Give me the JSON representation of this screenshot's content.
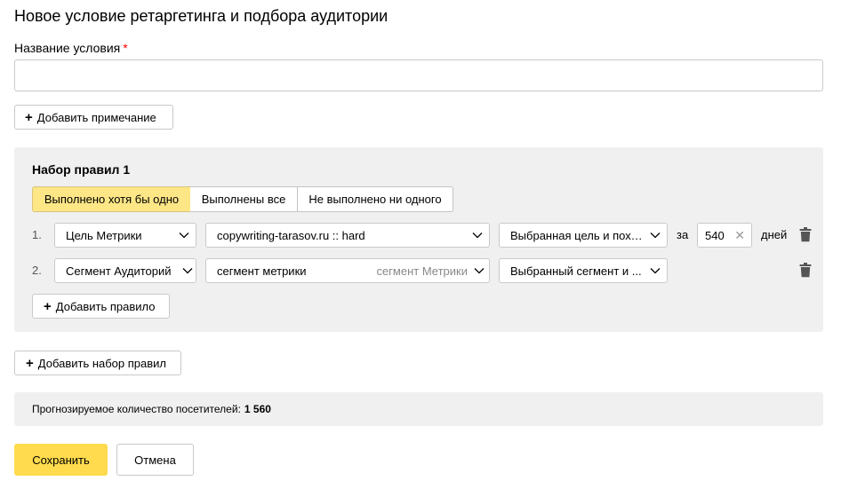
{
  "page_title": "Новое условие ретаргетинга и подбора аудитории",
  "name_field": {
    "label": "Название условия",
    "required_mark": "*",
    "value": ""
  },
  "add_note_label": "Добавить примечание",
  "ruleset": {
    "title": "Набор правил 1",
    "modes": [
      "Выполнено хотя бы одно",
      "Выполнены все",
      "Не выполнено ни одного"
    ],
    "active_mode": "Выполнено хотя бы одно",
    "rules": [
      {
        "number": "1.",
        "type": "Цель Метрики",
        "target": "copywriting-tarasov.ru :: hard",
        "target_hint": "",
        "condition": "Выбранная цель и похо...",
        "period_prefix": "за",
        "period_value": "540",
        "period_suffix": "дней"
      },
      {
        "number": "2.",
        "type": "Сегмент Аудиторий",
        "target": "сегмент метрики",
        "target_hint": "сегмент Метрики",
        "condition": "Выбранный сегмент и ..."
      }
    ],
    "add_rule_label": "Добавить правило"
  },
  "add_ruleset_label": "Добавить набор правил",
  "forecast": {
    "label": "Прогнозируемое количество посетителей:",
    "value": "1 560"
  },
  "actions": {
    "save": "Сохранить",
    "cancel": "Отмена"
  },
  "colors": {
    "accent": "#ffdb4d",
    "active_segment": "#fde686",
    "panel_bg": "#f0f0f0",
    "required": "#ff0000"
  },
  "icons": {
    "plus": "plus-icon",
    "chevron": "chevron-down-icon",
    "clear": "clear-icon",
    "trash": "trash-icon"
  }
}
